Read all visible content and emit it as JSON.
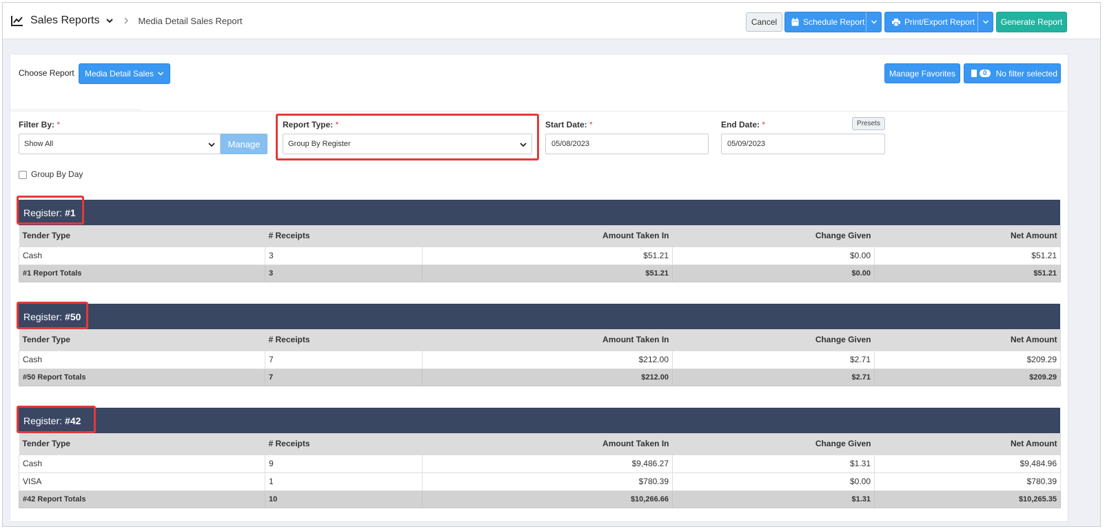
{
  "header": {
    "app_title": "Sales Reports",
    "breadcrumb": "Media Detail Sales Report",
    "buttons": {
      "cancel": "Cancel",
      "schedule": "Schedule Report",
      "print_export": "Print/Export Report",
      "generate": "Generate Report"
    }
  },
  "report_selector": {
    "label": "Choose Report",
    "selected": "Media Detail Sales",
    "manage_favorites": "Manage Favorites",
    "filter_count": "0",
    "filter_text": "No filter selected"
  },
  "filters": {
    "filter_by": {
      "label": "Filter By:",
      "value": "Show All",
      "manage": "Manage"
    },
    "report_type": {
      "label": "Report Type:",
      "value": "Group By Register"
    },
    "start_date": {
      "label": "Start Date:",
      "value": "05/08/2023"
    },
    "end_date": {
      "label": "End Date:",
      "value": "05/09/2023"
    },
    "presets": "Presets",
    "required_mark": "*",
    "group_by_day": "Group By Day"
  },
  "columns": [
    "Tender Type",
    "# Receipts",
    "Amount Taken In",
    "Change Given",
    "Net Amount"
  ],
  "registers": [
    {
      "label": "Register:",
      "number": "#1",
      "rows": [
        [
          "Cash",
          "3",
          "$51.21",
          "$0.00",
          "$51.21"
        ]
      ],
      "totals": [
        "#1 Report Totals",
        "3",
        "$51.21",
        "$0.00",
        "$51.21"
      ]
    },
    {
      "label": "Register:",
      "number": "#50",
      "rows": [
        [
          "Cash",
          "7",
          "$212.00",
          "$2.71",
          "$209.29"
        ]
      ],
      "totals": [
        "#50 Report Totals",
        "7",
        "$212.00",
        "$2.71",
        "$209.29"
      ]
    },
    {
      "label": "Register:",
      "number": "#42",
      "rows": [
        [
          "Cash",
          "9",
          "$9,486.27",
          "$1.31",
          "$9,484.96"
        ],
        [
          "VISA",
          "1",
          "$780.39",
          "$0.00",
          "$780.39"
        ]
      ],
      "totals": [
        "#42 Report Totals",
        "10",
        "$10,266.66",
        "$1.31",
        "$10,265.35"
      ]
    }
  ]
}
